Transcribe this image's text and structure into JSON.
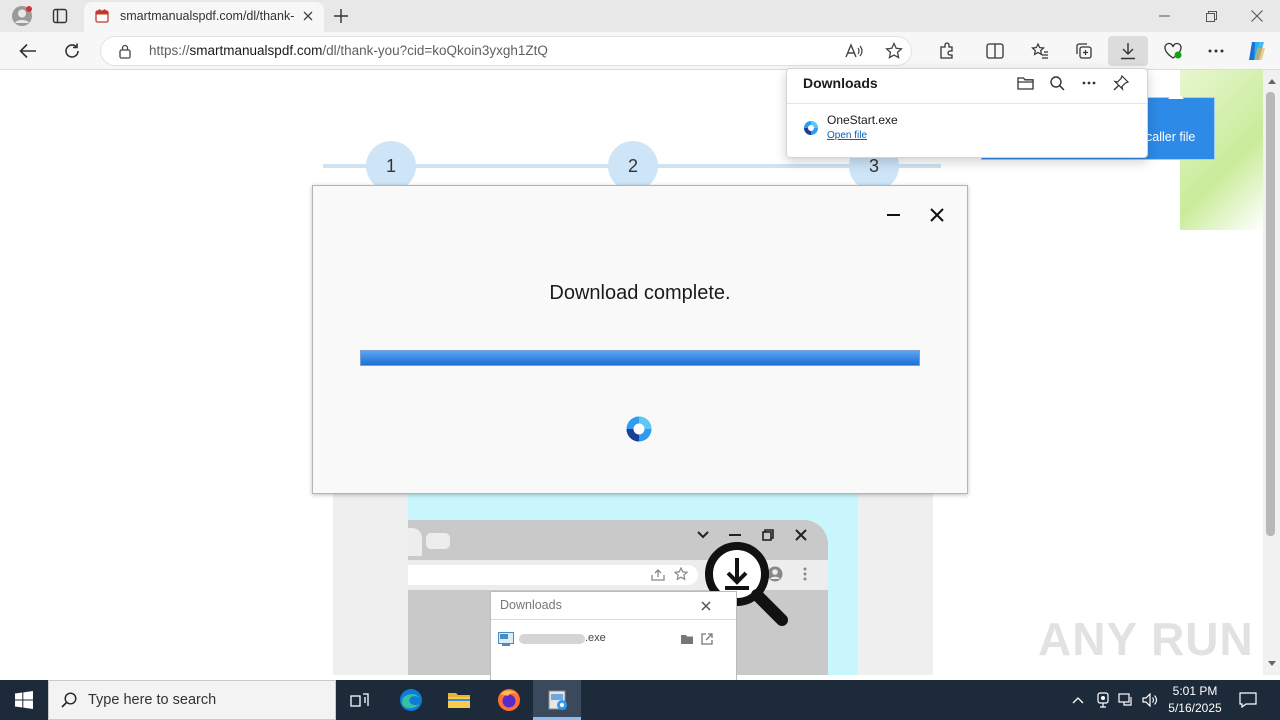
{
  "browser": {
    "tab": {
      "title": "smartmanualspdf.com/dl/thank-"
    },
    "address": {
      "scheme": "https://",
      "host": "smartmanualspdf.com",
      "path": "/dl/thank-you?cid=koQkoin3yxgh1ZtQ"
    }
  },
  "page": {
    "steps": [
      {
        "label": "1"
      },
      {
        "label": "2"
      },
      {
        "label": "3"
      }
    ],
    "hint_text": "caller file",
    "illustration": {
      "downloads_title": "Downloads",
      "file_ext": ".exe"
    }
  },
  "dialog": {
    "message": "Download complete.",
    "progress": 1.0
  },
  "downloads_flyout": {
    "title": "Downloads",
    "items": [
      {
        "file_name": "OneStart.exe",
        "action_label": "Open file"
      }
    ]
  },
  "watermark": {
    "text": "ANY RUN"
  },
  "taskbar": {
    "search_placeholder": "Type here to search",
    "time": "5:01 PM",
    "date": "5/16/2025"
  },
  "colors": {
    "accent": "#2d8ae6",
    "progress": "#1d6fd6",
    "taskbar": "#1c2a3a"
  }
}
